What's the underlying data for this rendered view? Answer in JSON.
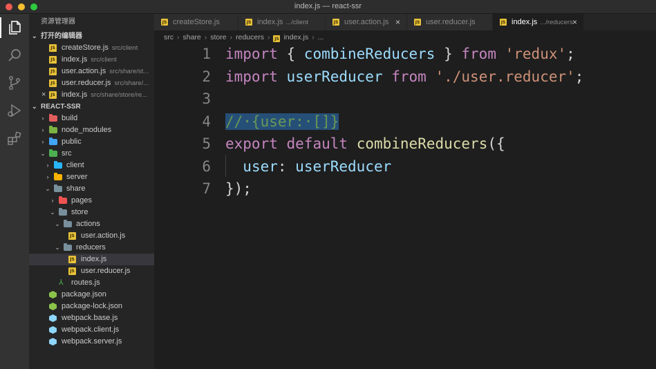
{
  "window": {
    "title": "index.js — react-ssr"
  },
  "activity_bar": [
    {
      "name": "explorer-icon",
      "active": true
    },
    {
      "name": "search-icon",
      "active": false
    },
    {
      "name": "source-control-icon",
      "active": false
    },
    {
      "name": "run-debug-icon",
      "active": false
    },
    {
      "name": "extensions-icon",
      "active": false
    }
  ],
  "sidebar": {
    "title": "资源管理器",
    "open_editors": {
      "title": "打开的编辑器",
      "items": [
        {
          "label": "createStore.js",
          "desc": "src/client"
        },
        {
          "label": "index.js",
          "desc": "src/client"
        },
        {
          "label": "user.action.js",
          "desc": "src/share/st..."
        },
        {
          "label": "user.reducer.js",
          "desc": "src/share/..."
        },
        {
          "label": "index.js",
          "desc": "src/share/store/re..."
        }
      ]
    },
    "project": {
      "title": "REACT-SSR",
      "tree": [
        {
          "label": "build",
          "type": "folder",
          "color": "#e25d5d",
          "depth": 0,
          "expanded": false
        },
        {
          "label": "node_modules",
          "type": "folder",
          "color": "#7cb342",
          "depth": 0,
          "expanded": false
        },
        {
          "label": "public",
          "type": "folder",
          "color": "#42a5f5",
          "depth": 0,
          "expanded": false
        },
        {
          "label": "src",
          "type": "folder",
          "color": "#4caf50",
          "depth": 0,
          "expanded": true
        },
        {
          "label": "client",
          "type": "folder",
          "color": "#29b6f6",
          "depth": 1,
          "expanded": false
        },
        {
          "label": "server",
          "type": "folder",
          "color": "#ffb300",
          "depth": 1,
          "expanded": false
        },
        {
          "label": "share",
          "type": "folder",
          "color": "#78909c",
          "depth": 1,
          "expanded": true
        },
        {
          "label": "pages",
          "type": "folder",
          "color": "#ef5350",
          "depth": 2,
          "expanded": false
        },
        {
          "label": "store",
          "type": "folder",
          "color": "#78909c",
          "depth": 2,
          "expanded": true
        },
        {
          "label": "actions",
          "type": "folder",
          "color": "#78909c",
          "depth": 3,
          "expanded": true
        },
        {
          "label": "user.action.js",
          "type": "js",
          "depth": 4
        },
        {
          "label": "reducers",
          "type": "folder",
          "color": "#78909c",
          "depth": 3,
          "expanded": true
        },
        {
          "label": "index.js",
          "type": "js",
          "depth": 4,
          "selected": true
        },
        {
          "label": "user.reducer.js",
          "type": "js",
          "depth": 4
        },
        {
          "label": "routes.js",
          "type": "routes",
          "depth": 2
        },
        {
          "label": "package.json",
          "type": "node",
          "depth": 0
        },
        {
          "label": "package-lock.json",
          "type": "node",
          "depth": 0
        },
        {
          "label": "webpack.base.js",
          "type": "webpack",
          "depth": 0
        },
        {
          "label": "webpack.client.js",
          "type": "webpack",
          "depth": 0
        },
        {
          "label": "webpack.server.js",
          "type": "webpack",
          "depth": 0
        }
      ]
    }
  },
  "tabs": [
    {
      "label": "createStore.js",
      "desc": "",
      "active": false
    },
    {
      "label": "index.js",
      "desc": ".../client",
      "active": false
    },
    {
      "label": "user.action.js",
      "desc": "",
      "active": false
    },
    {
      "label": "user.reducer.js",
      "desc": "",
      "active": false
    },
    {
      "label": "index.js",
      "desc": ".../reducers",
      "active": true
    }
  ],
  "breadcrumb": [
    "src",
    "share",
    "store",
    "reducers",
    "index.js",
    "..."
  ],
  "editor": {
    "line_numbers": [
      "1",
      "2",
      "3",
      "4",
      "5",
      "6",
      "7"
    ],
    "lines": [
      [
        {
          "t": "import",
          "c": "kw"
        },
        {
          "t": " { ",
          "c": "punc"
        },
        {
          "t": "combineReducers",
          "c": "var"
        },
        {
          "t": " } ",
          "c": "punc"
        },
        {
          "t": "from",
          "c": "kw"
        },
        {
          "t": " ",
          "c": "punc"
        },
        {
          "t": "'redux'",
          "c": "str"
        },
        {
          "t": ";",
          "c": "punc"
        }
      ],
      [
        {
          "t": "import",
          "c": "kw"
        },
        {
          "t": " ",
          "c": "punc"
        },
        {
          "t": "userReducer",
          "c": "var"
        },
        {
          "t": " ",
          "c": "punc"
        },
        {
          "t": "from",
          "c": "kw"
        },
        {
          "t": " ",
          "c": "punc"
        },
        {
          "t": "'./user.reducer'",
          "c": "str"
        },
        {
          "t": ";",
          "c": "punc"
        }
      ],
      [],
      [
        {
          "t": "//·{user:·[]}",
          "c": "cmt"
        }
      ],
      [
        {
          "t": "export",
          "c": "kw"
        },
        {
          "t": " ",
          "c": "punc"
        },
        {
          "t": "default",
          "c": "kw"
        },
        {
          "t": " ",
          "c": "punc"
        },
        {
          "t": "combineReducers",
          "c": "fn"
        },
        {
          "t": "({",
          "c": "punc"
        }
      ],
      [
        {
          "t": "  ",
          "c": "punc"
        },
        {
          "t": "user",
          "c": "var"
        },
        {
          "t": ": ",
          "c": "punc"
        },
        {
          "t": "userReducer",
          "c": "var"
        }
      ],
      [
        {
          "t": "});",
          "c": "punc"
        }
      ]
    ]
  },
  "colors": {
    "js_badge": "#e8c13a",
    "selection": "#264f78",
    "keyword": "#c586c0",
    "string": "#ce9178",
    "variable": "#9cdcfe",
    "function": "#dcdcaa",
    "comment": "#6a9955"
  }
}
